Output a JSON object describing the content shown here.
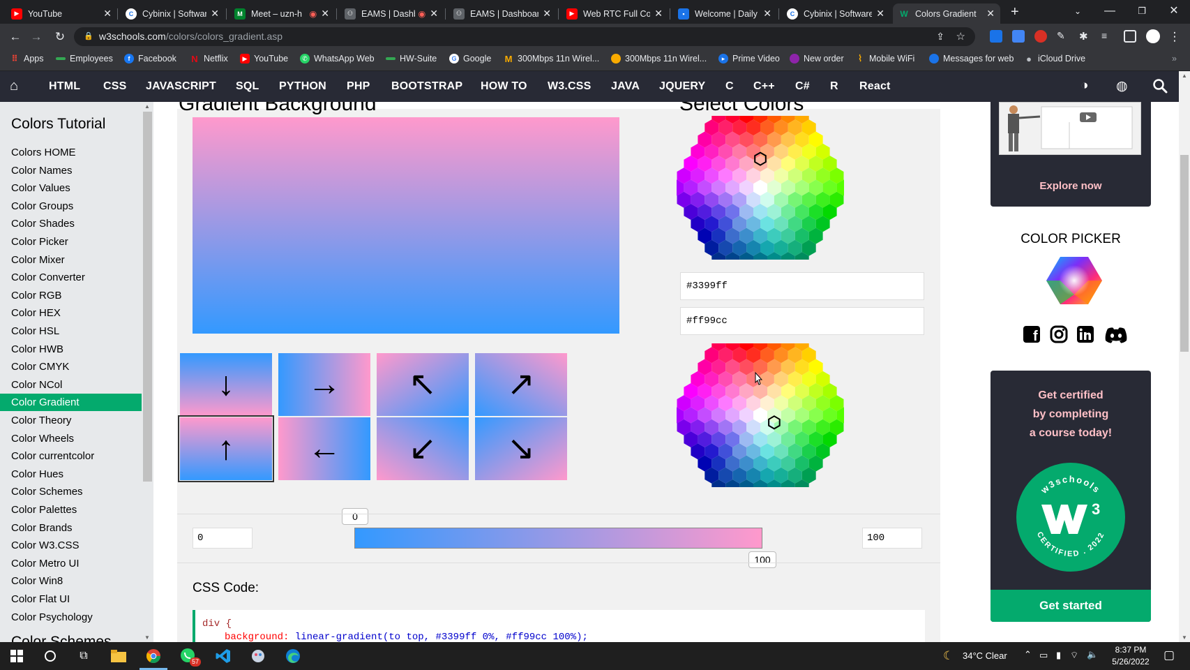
{
  "browser": {
    "tabs": [
      {
        "title": "YouTube",
        "favicon": "youtube-icon"
      },
      {
        "title": "Cybinix | Software",
        "favicon": "cybinix-icon"
      },
      {
        "title": "Meet – uzn-h",
        "favicon": "meet-icon"
      },
      {
        "title": "EAMS | Dashb",
        "favicon": "eams-icon"
      },
      {
        "title": "EAMS | Dashboar",
        "favicon": "eams-icon"
      },
      {
        "title": "Web RTC Full Cou",
        "favicon": "youtube-icon"
      },
      {
        "title": "Welcome | Daily",
        "favicon": "daily-icon"
      },
      {
        "title": "Cybinix | Software",
        "favicon": "cybinix-icon"
      },
      {
        "title": "Colors Gradient",
        "favicon": "w3schools-icon",
        "active": true
      }
    ],
    "new_tab": "+",
    "url_host": "w3schools.com",
    "url_path": "/colors/colors_gradient.asp",
    "bookmarks": [
      {
        "label": "Apps"
      },
      {
        "label": "Employees"
      },
      {
        "label": "Facebook"
      },
      {
        "label": "Netflix"
      },
      {
        "label": "YouTube"
      },
      {
        "label": "WhatsApp Web"
      },
      {
        "label": "HW-Suite"
      },
      {
        "label": "Google"
      },
      {
        "label": "300Mbps 11n Wirel..."
      },
      {
        "label": "300Mbps 11n Wirel..."
      },
      {
        "label": "Prime Video"
      },
      {
        "label": "New order"
      },
      {
        "label": "Mobile WiFi"
      },
      {
        "label": "Messages for web"
      },
      {
        "label": "iCloud Drive"
      }
    ]
  },
  "topnav": {
    "items": [
      "HTML",
      "CSS",
      "JAVASCRIPT",
      "SQL",
      "PYTHON",
      "PHP",
      "BOOTSTRAP",
      "HOW TO",
      "W3.CSS",
      "JAVA",
      "JQUERY",
      "C",
      "C++",
      "C#",
      "R",
      "React"
    ]
  },
  "sidebar": {
    "title": "Colors Tutorial",
    "items": [
      "Colors HOME",
      "Color Names",
      "Color Values",
      "Color Groups",
      "Color Shades",
      "Color Picker",
      "Color Mixer",
      "Color Converter",
      "Color RGB",
      "Color HEX",
      "Color HSL",
      "Color HWB",
      "Color CMYK",
      "Color NCol",
      "Color Gradient",
      "Color Theory",
      "Color Wheels",
      "Color currentcolor",
      "Color Hues",
      "Color Schemes",
      "Color Palettes",
      "Color Brands",
      "Color W3.CSS",
      "Color Metro UI",
      "Color Win8",
      "Color Flat UI",
      "Color Psychology"
    ],
    "active_index": 14,
    "next_heading": "Color Schemes"
  },
  "main": {
    "heading_partial": "Gradient Background",
    "picker_heading_partial": "Select Colors",
    "color1": "#3399ff",
    "color2": "#ff99cc",
    "directions": [
      {
        "arrow": "↓",
        "name": "to-bottom"
      },
      {
        "arrow": "→",
        "name": "to-right"
      },
      {
        "arrow": "↖",
        "name": "to-top-left"
      },
      {
        "arrow": "↗",
        "name": "to-top-right"
      },
      {
        "arrow": "↑",
        "name": "to-top",
        "selected": true
      },
      {
        "arrow": "←",
        "name": "to-left"
      },
      {
        "arrow": "↙",
        "name": "to-bottom-left"
      },
      {
        "arrow": "↘",
        "name": "to-bottom-right"
      }
    ],
    "stop_start_input": "0",
    "stop_end_input": "100",
    "stop_start_bubble": "0",
    "stop_end_bubble": "100",
    "css_label": "CSS Code:",
    "code_line1": "div {",
    "code_prop": "background:",
    "code_value": "linear-gradient(to top, #3399ff 0%, #ff99cc 100%);"
  },
  "rightrail": {
    "explore_label": "Explore now",
    "picker_title": "COLOR PICKER",
    "cert_lines": [
      "Get certified",
      "by completing",
      "a course today!"
    ],
    "badge_top": "w3schools",
    "badge_bottom": "CERTIFIED . 2022",
    "get_started": "Get started"
  },
  "taskbar": {
    "whatsapp_badge": "57",
    "weather": "34°C  Clear",
    "time": "8:37 PM",
    "date": "5/26/2022"
  },
  "colors": {
    "w3_green": "#04aa6d",
    "w3_dark": "#282a35",
    "cert_pink": "#ffc0c7"
  }
}
